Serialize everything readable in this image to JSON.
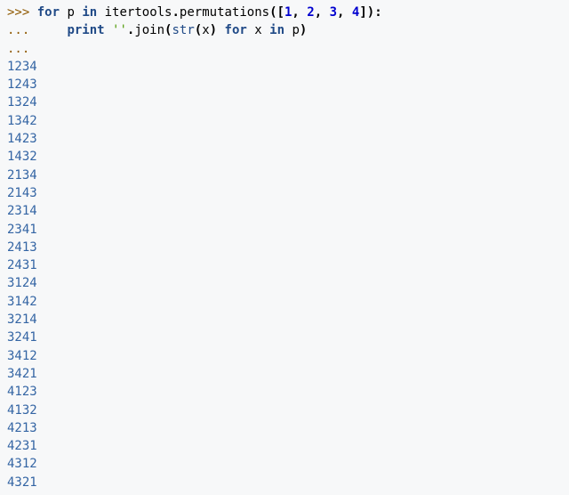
{
  "code": {
    "line1": {
      "prompt": ">>> ",
      "kw_for": "for",
      "sp1": " ",
      "var_p": "p",
      "sp2": " ",
      "kw_in": "in",
      "sp3": " ",
      "mod": "itertools",
      "dot1": ".",
      "func": "permutations",
      "lpar": "(",
      "lbr": "[",
      "n1": "1",
      "c1": ",",
      "sp4": " ",
      "n2": "2",
      "c2": ",",
      "sp5": " ",
      "n3": "3",
      "c3": ",",
      "sp6": " ",
      "n4": "4",
      "rbr": "]",
      "rpar": ")",
      "colon": ":"
    },
    "line2": {
      "prompt": "... ",
      "indent": "    ",
      "kw_print": "print",
      "sp1": " ",
      "str_empty": "''",
      "dot": ".",
      "join": "join",
      "lpar": "(",
      "strfn": "str",
      "lpar2": "(",
      "x1": "x",
      "rpar2": ")",
      "sp2": " ",
      "kw_for": "for",
      "sp3": " ",
      "x2": "x",
      "sp4": " ",
      "kw_in": "in",
      "sp5": " ",
      "p": "p",
      "rpar": ")"
    },
    "line3": {
      "prompt": "..."
    }
  },
  "output": [
    "1234",
    "1243",
    "1324",
    "1342",
    "1423",
    "1432",
    "2134",
    "2143",
    "2314",
    "2341",
    "2413",
    "2431",
    "3124",
    "3142",
    "3214",
    "3241",
    "3412",
    "3421",
    "4123",
    "4132",
    "4213",
    "4231",
    "4312",
    "4321"
  ]
}
